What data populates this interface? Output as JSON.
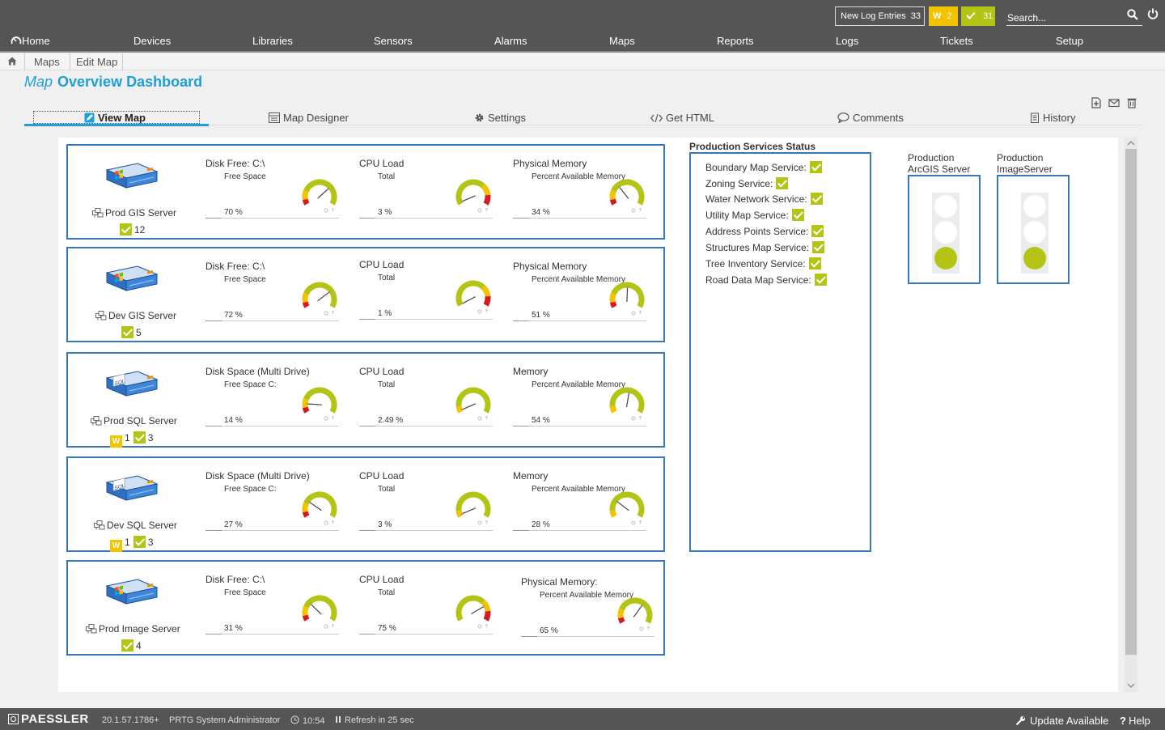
{
  "topbar": {
    "log_label": "New Log Entries",
    "log_count": "33",
    "warning_letter": "W",
    "warning_count": "2",
    "ok_count": "31",
    "search_placeholder": "Search..."
  },
  "nav": [
    "Home",
    "Devices",
    "Libraries",
    "Sensors",
    "Alarms",
    "Maps",
    "Reports",
    "Logs",
    "Tickets",
    "Setup"
  ],
  "breadcrumb": [
    "Maps",
    "Edit Map"
  ],
  "page_title": {
    "prefix": "Map",
    "name": "Overview Dashboard"
  },
  "tabs": [
    "View Map",
    "Map Designer",
    "Settings",
    "Get HTML",
    "Comments",
    "History"
  ],
  "colors": {
    "accent": "#1f9fd8",
    "frame": "#3678b8",
    "ok": "#b4c414",
    "warning": "#f4c300",
    "error": "#d71920"
  },
  "servers": [
    {
      "name": "Prod GIS Server",
      "warnings": "",
      "ok": "12",
      "os": "windows",
      "gauges": [
        {
          "title": "Disk Free: C:\\",
          "sub": "Free Space",
          "value": "70 %",
          "level": 70,
          "red": "low"
        },
        {
          "title": "CPU Load",
          "sub": "Total",
          "value": "3 %",
          "level": 3,
          "red": "high"
        },
        {
          "title": "Physical Memory",
          "sub": "Percent Available Memory",
          "value": "34 %",
          "level": 34,
          "red": "low"
        }
      ]
    },
    {
      "name": "Dev GIS Server",
      "warnings": "",
      "ok": "5",
      "os": "windows",
      "gauges": [
        {
          "title": "Disk Free: C:\\",
          "sub": "Free Space",
          "value": "72 %",
          "level": 72,
          "red": "low"
        },
        {
          "title": "CPU Load",
          "sub": "Total",
          "value": "1 %",
          "level": 1,
          "red": "high"
        },
        {
          "title": "Physical Memory",
          "sub": "Percent Available Memory",
          "value": "51 %",
          "level": 51,
          "red": "low"
        }
      ]
    },
    {
      "name": "Prod SQL Server",
      "warnings": "1",
      "ok": "3",
      "os": "sql",
      "gauges": [
        {
          "title": "Disk Space (Multi Drive)",
          "sub": "Free Space C:",
          "value": "14 %",
          "level": 14,
          "red": "low"
        },
        {
          "title": "CPU Load",
          "sub": "Total",
          "value": "2.49 %",
          "level": 2.49,
          "red": "none"
        },
        {
          "title": "Memory",
          "sub": "Percent Available Memory",
          "value": "54 %",
          "level": 54,
          "red": "none"
        }
      ]
    },
    {
      "name": "Dev SQL Server",
      "warnings": "1",
      "ok": "3",
      "os": "sql",
      "gauges": [
        {
          "title": "Disk Space (Multi Drive)",
          "sub": "Free Space C:",
          "value": "27 %",
          "level": 27,
          "red": "low"
        },
        {
          "title": "CPU Load",
          "sub": "Total",
          "value": "3 %",
          "level": 3,
          "red": "none"
        },
        {
          "title": "Memory",
          "sub": "Percent Available Memory",
          "value": "28 %",
          "level": 28,
          "red": "none"
        }
      ]
    },
    {
      "name": "Prod Image Server",
      "warnings": "",
      "ok": "4",
      "os": "windows",
      "gauges": [
        {
          "title": "Disk Free: C:\\",
          "sub": "Free Space",
          "value": "31 %",
          "level": 31,
          "red": "low"
        },
        {
          "title": "CPU Load",
          "sub": "Total",
          "value": "75 %",
          "level": 75,
          "red": "high"
        },
        {
          "title": "Physical Memory:",
          "sub": "Percent Available Memory",
          "value": "65 %",
          "level": 65,
          "red": "low"
        }
      ]
    }
  ],
  "production_services": {
    "title": "Production Services Status",
    "items": [
      "Boundary Map Service:",
      "Zoning Service:",
      "Water Network Service:",
      "Utility Map Service:",
      "Address Points Service:",
      "Structures Map Service:",
      "Tree Inventory Service:",
      "Road Data Map Service:"
    ]
  },
  "traffic_lights": [
    {
      "line1": "Production",
      "line2": "ArcGIS Server",
      "active": "green"
    },
    {
      "line1": "Production",
      "line2": "ImageServer",
      "active": "green"
    }
  ],
  "footer": {
    "brand": "PAESSLER",
    "version": "20.1.57.1786+",
    "user": "PRTG System Administrator",
    "time": "10:54",
    "refresh": "Refresh in 25 sec",
    "update": "Update Available",
    "help": "Help"
  }
}
